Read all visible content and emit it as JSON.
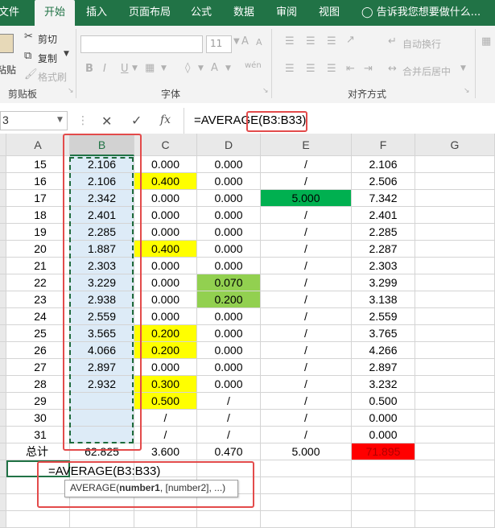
{
  "tabs": [
    {
      "label": "文件",
      "active": false
    },
    {
      "label": "开始",
      "active": true
    },
    {
      "label": "插入",
      "active": false
    },
    {
      "label": "页面布局",
      "active": false
    },
    {
      "label": "公式",
      "active": false
    },
    {
      "label": "数据",
      "active": false
    },
    {
      "label": "审阅",
      "active": false
    },
    {
      "label": "视图",
      "active": false
    }
  ],
  "tell_me": "告诉我您想要做什么...",
  "ribbon": {
    "clipboard": {
      "cut": "剪切",
      "copy": "复制",
      "format_painter": "格式刷",
      "paste": "粘贴",
      "group_label": "剪贴板"
    },
    "font": {
      "size": "11",
      "group_label": "字体"
    },
    "alignment": {
      "wrap": "自动换行",
      "merge": "合并后居中",
      "group_label": "对齐方式"
    }
  },
  "formula_bar": {
    "name_box": "3",
    "formula": "=AVERAGE(B3:B33)"
  },
  "columns": [
    "A",
    "B",
    "C",
    "D",
    "E",
    "F",
    "G"
  ],
  "rows": [
    [
      "15",
      "2.106",
      "0.000",
      "0.000",
      "/",
      "2.106"
    ],
    [
      "16",
      "2.106",
      "0.400",
      "0.000",
      "/",
      "2.506"
    ],
    [
      "17",
      "2.342",
      "0.000",
      "0.000",
      "5.000",
      "7.342"
    ],
    [
      "18",
      "2.401",
      "0.000",
      "0.000",
      "/",
      "2.401"
    ],
    [
      "19",
      "2.285",
      "0.000",
      "0.000",
      "/",
      "2.285"
    ],
    [
      "20",
      "1.887",
      "0.400",
      "0.000",
      "/",
      "2.287"
    ],
    [
      "21",
      "2.303",
      "0.000",
      "0.000",
      "/",
      "2.303"
    ],
    [
      "22",
      "3.229",
      "0.000",
      "0.070",
      "/",
      "3.299"
    ],
    [
      "23",
      "2.938",
      "0.000",
      "0.200",
      "/",
      "3.138"
    ],
    [
      "24",
      "2.559",
      "0.000",
      "0.000",
      "/",
      "2.559"
    ],
    [
      "25",
      "3.565",
      "0.200",
      "0.000",
      "/",
      "3.765"
    ],
    [
      "26",
      "4.066",
      "0.200",
      "0.000",
      "/",
      "4.266"
    ],
    [
      "27",
      "2.897",
      "0.000",
      "0.000",
      "/",
      "2.897"
    ],
    [
      "28",
      "2.932",
      "0.300",
      "0.000",
      "/",
      "3.232"
    ],
    [
      "29",
      "",
      "0.500",
      "/",
      "/",
      "0.500"
    ],
    [
      "30",
      "",
      "/",
      "/",
      "/",
      "0.000"
    ],
    [
      "31",
      "",
      "/",
      "/",
      "/",
      "0.000"
    ],
    [
      "总计",
      "62.825",
      "3.600",
      "0.470",
      "5.000",
      "71.895"
    ]
  ],
  "edit_cell": "=AVERAGE(B3:B33)",
  "tooltip": {
    "func": "AVERAGE(",
    "arg1": "number1",
    "rest": ", [number2], ...)"
  },
  "colors": {
    "ribbon_green": "#217346",
    "yellow": "#ffff00",
    "green": "#92d050",
    "dark_green": "#00b050",
    "red": "#ff0000",
    "range_fill": "#ddebf7",
    "annotation_red": "#e34b4b"
  }
}
